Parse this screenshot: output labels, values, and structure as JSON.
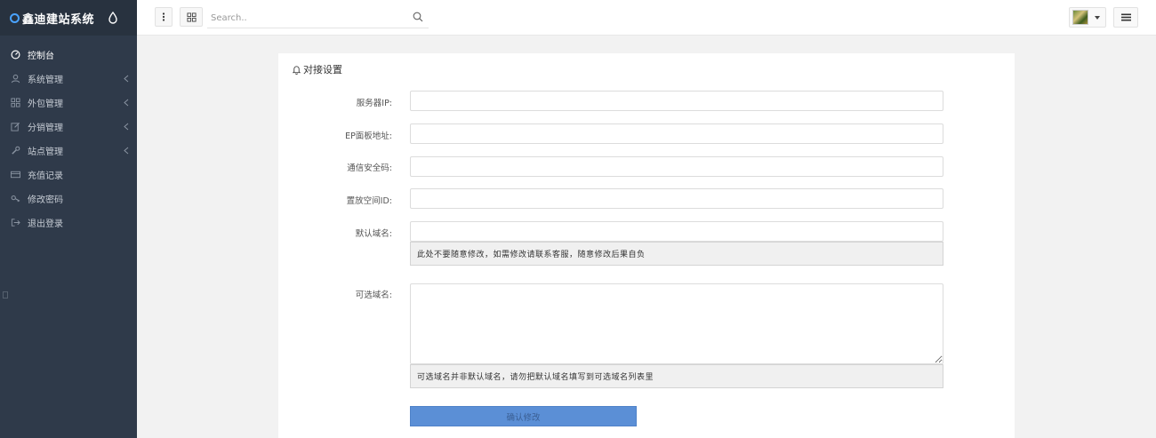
{
  "sidebar": {
    "brand_title": "鑫迪建站系统",
    "items": [
      {
        "label": "控制台",
        "icon": "dashboard-icon",
        "has_submenu": false,
        "active": true
      },
      {
        "label": "系统管理",
        "icon": "user-icon",
        "has_submenu": true,
        "active": false
      },
      {
        "label": "外包管理",
        "icon": "grid-icon",
        "has_submenu": true,
        "active": false
      },
      {
        "label": "分销管理",
        "icon": "edit-icon",
        "has_submenu": true,
        "active": false
      },
      {
        "label": "站点管理",
        "icon": "wrench-icon",
        "has_submenu": true,
        "active": false
      },
      {
        "label": "充值记录",
        "icon": "card-icon",
        "has_submenu": false,
        "active": false
      },
      {
        "label": "修改密码",
        "icon": "key-icon",
        "has_submenu": false,
        "active": false
      },
      {
        "label": "退出登录",
        "icon": "logout-icon",
        "has_submenu": false,
        "active": false
      }
    ]
  },
  "topbar": {
    "search_placeholder": "Search.."
  },
  "panel": {
    "title": "对接设置",
    "fields": {
      "server_ip_label": "服务器IP:",
      "ep_panel_label": "EP面板地址:",
      "security_code_label": "通信安全码:",
      "space_id_label": "置放空间ID:",
      "default_domain_label": "默认域名:",
      "default_domain_hint": "此处不要随意修改，如需修改请联系客服，随意修改后果自负",
      "optional_domain_label": "可选域名:",
      "optional_domain_hint": "可选域名并非默认域名，请勿把默认域名填写到可选域名列表里"
    },
    "submit_label": "确认修改"
  },
  "colors": {
    "sidebar_bg": "#2f3a4a",
    "brand_bg": "#28323f",
    "accent": "#5b8fd6"
  }
}
